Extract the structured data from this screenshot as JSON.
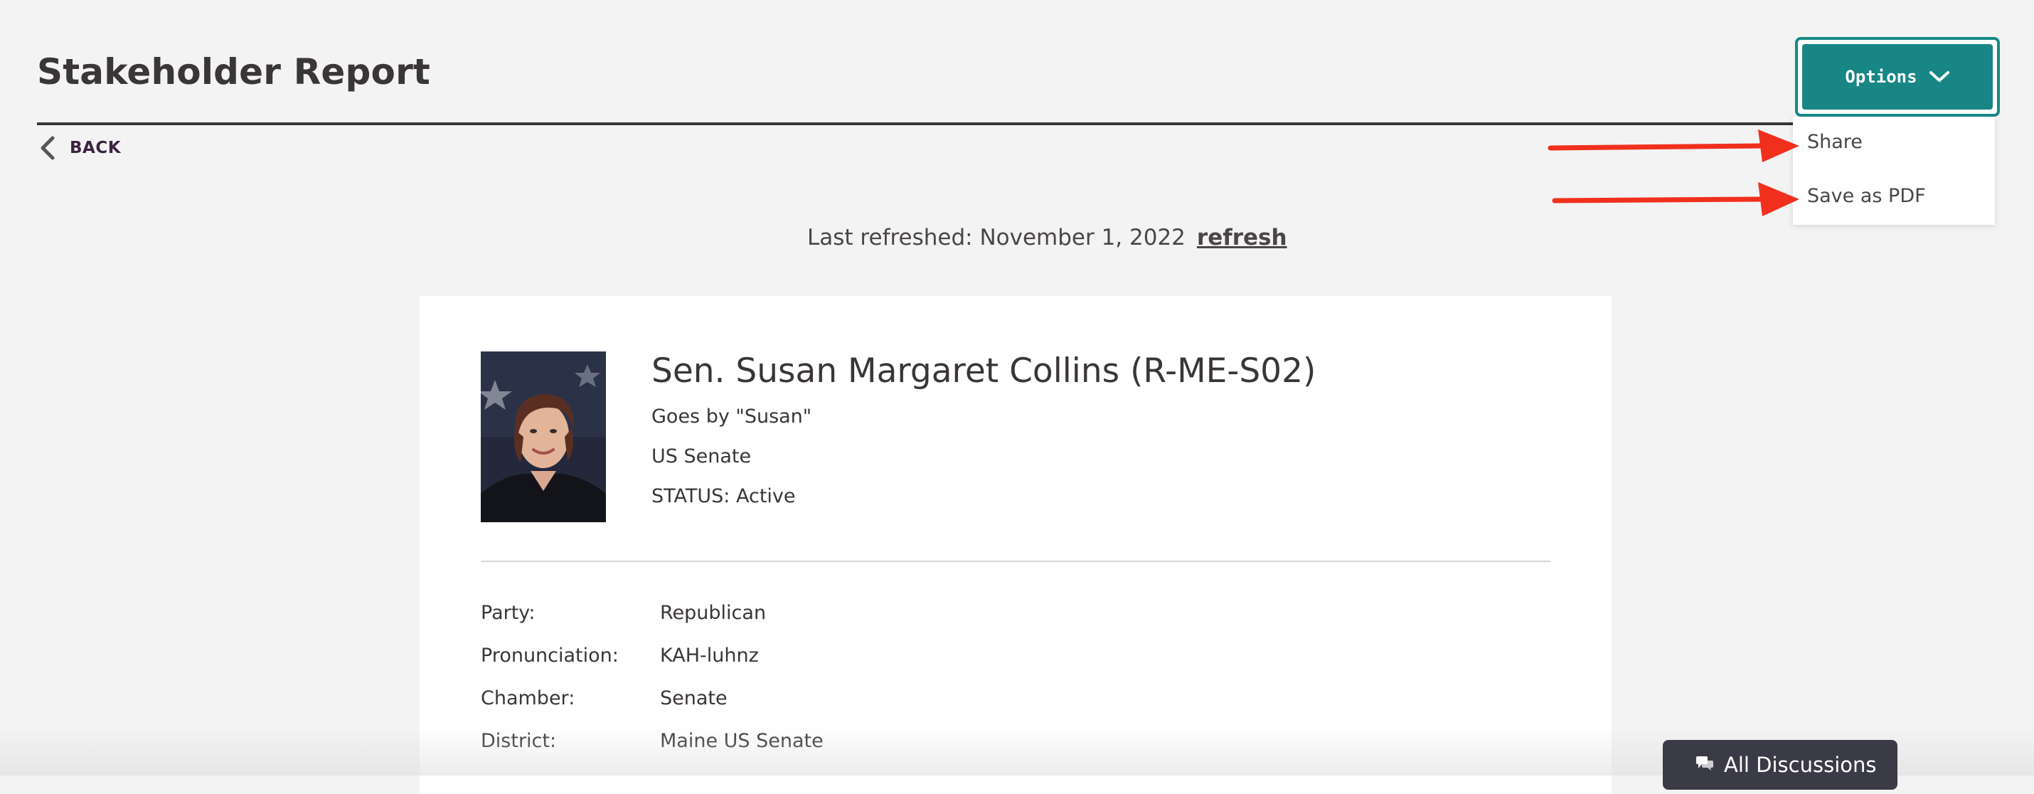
{
  "header": {
    "title": "Stakeholder Report",
    "back_label": "BACK"
  },
  "options": {
    "button_label": "Options",
    "menu_items": [
      "Share",
      "Save as PDF"
    ]
  },
  "refresh": {
    "label": "Last refreshed: November 1, 2022",
    "link": "refresh"
  },
  "profile": {
    "name": "Sen. Susan Margaret Collins (R-ME-S02)",
    "nickname": "Goes by \"Susan\"",
    "body": "US Senate",
    "status": "STATUS: Active"
  },
  "details": [
    {
      "label": "Party:",
      "value": "Republican"
    },
    {
      "label": "Pronunciation:",
      "value": "KAH-luhnz"
    },
    {
      "label": "Chamber:",
      "value": "Senate"
    },
    {
      "label": "District:",
      "value": "Maine US Senate"
    }
  ],
  "discussions": {
    "label": "All Discussions"
  },
  "colors": {
    "accent": "#178684",
    "annotation": "#f0301d",
    "text": "#3a3538",
    "background": "#f3f3f3"
  },
  "icons": {
    "back": "chevron-left-icon",
    "options": "chevron-down-icon",
    "discussions": "chat-bubble-icon"
  }
}
